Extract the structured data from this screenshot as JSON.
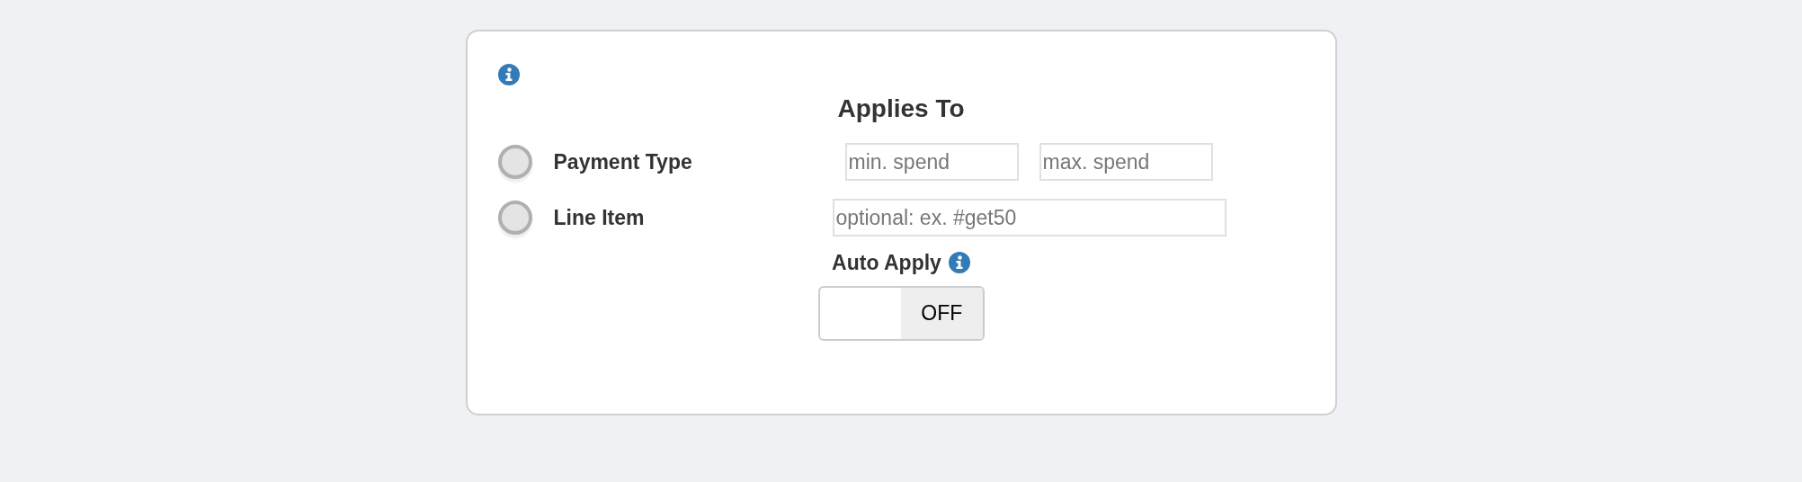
{
  "heading": "Applies To",
  "options": [
    {
      "label": "Payment Type",
      "selected": false,
      "fields": [
        {
          "placeholder": "min. spend"
        },
        {
          "placeholder": "max. spend"
        }
      ]
    },
    {
      "label": "Line Item",
      "selected": false,
      "fields": [
        {
          "placeholder": "optional: ex. #get50"
        }
      ]
    }
  ],
  "auto_apply": {
    "label": "Auto Apply",
    "toggle": {
      "on": false,
      "label": "OFF"
    }
  }
}
